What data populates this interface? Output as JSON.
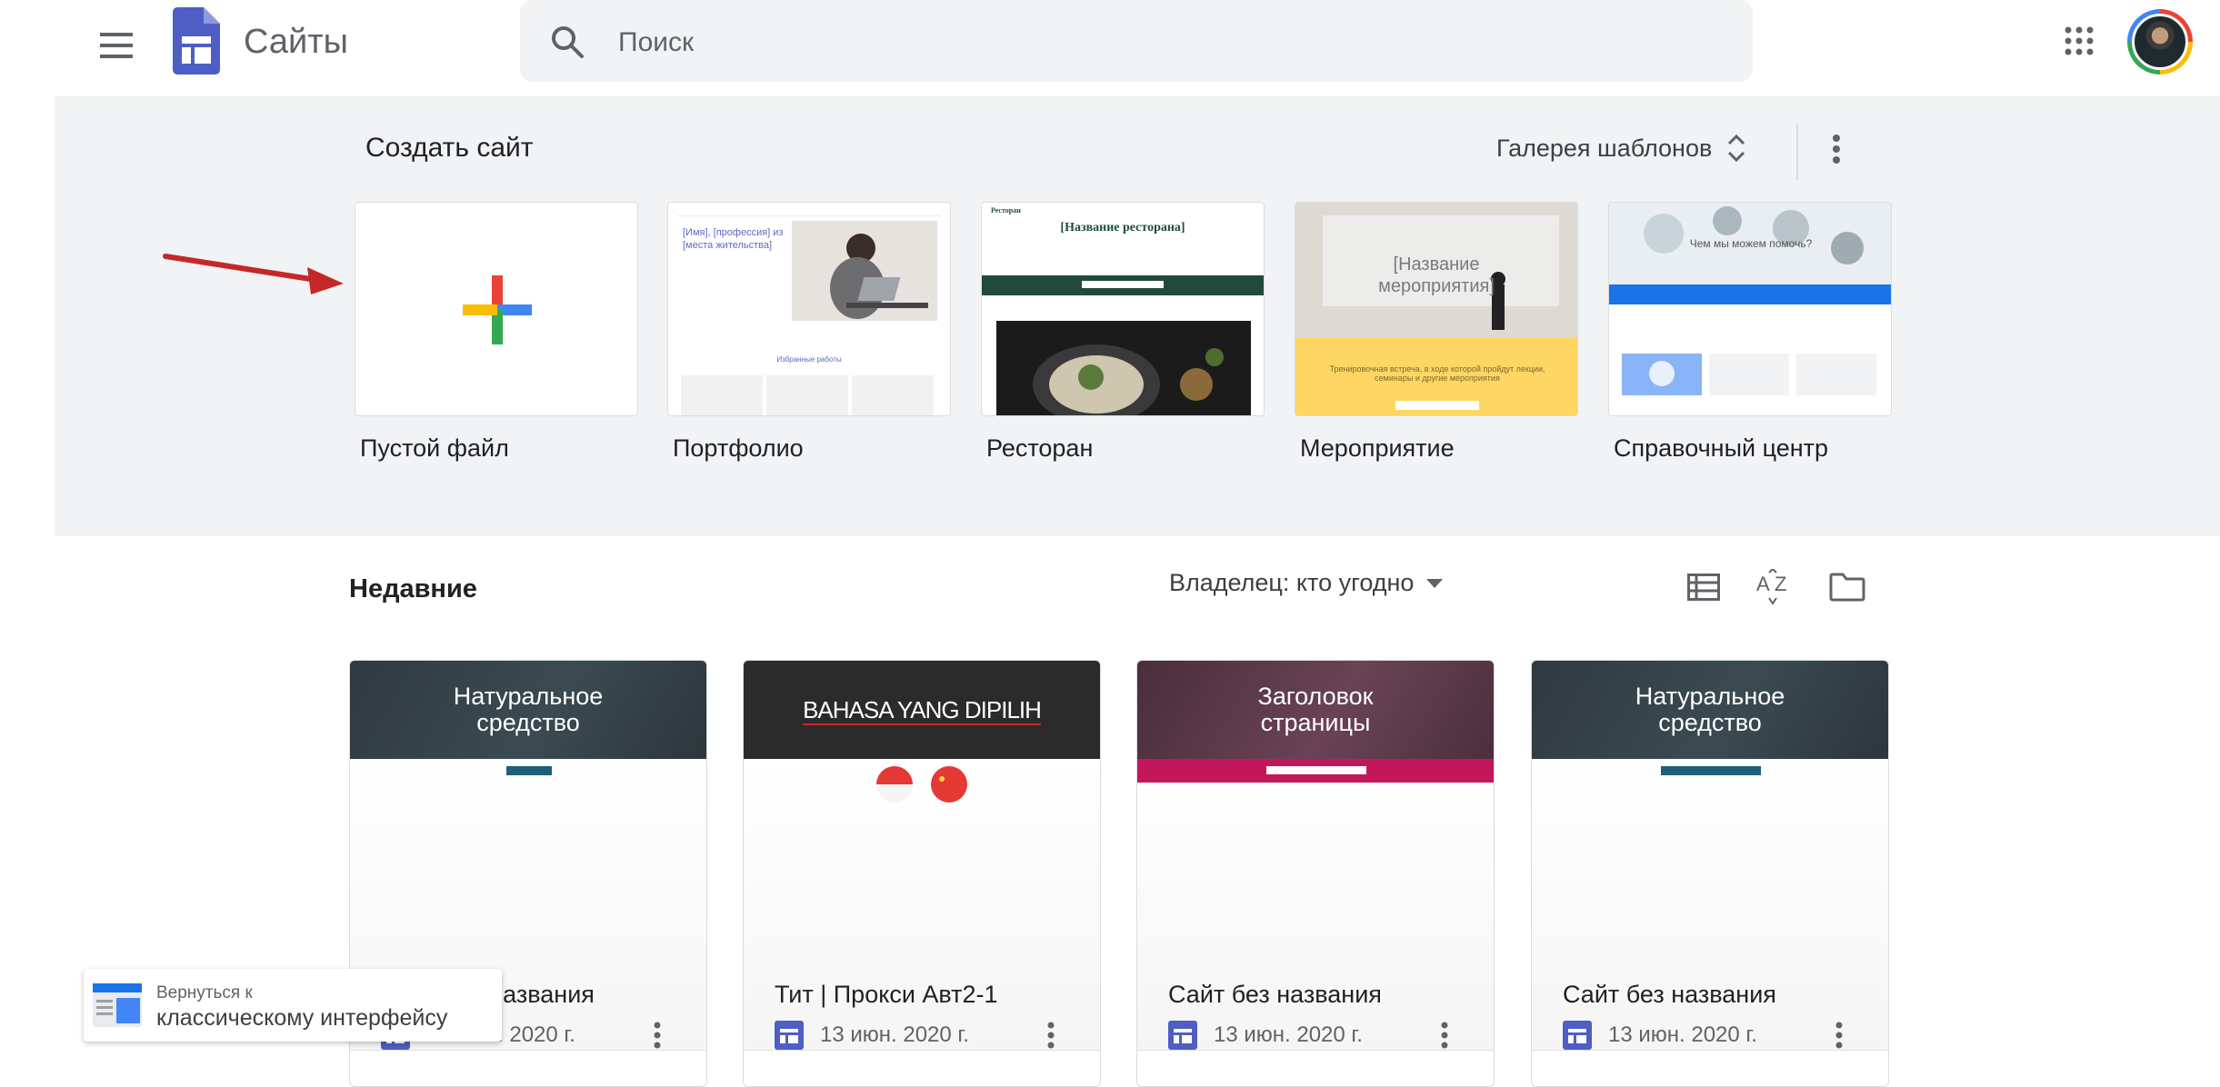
{
  "header": {
    "app_title": "Сайты",
    "search_placeholder": "Поиск",
    "icons": [
      "menu-icon",
      "sites-logo",
      "search-icon",
      "apps-grid-icon",
      "avatar"
    ]
  },
  "gallery": {
    "title": "Создать сайт",
    "gallery_link": "Галерея шаблонов",
    "templates": [
      {
        "label": "Пустой файл"
      },
      {
        "label": "Портфолио",
        "thumb_heading": "[Имя], [профессия] из [места жительства]",
        "thumb_caption": "Избранные работы"
      },
      {
        "label": "Ресторан",
        "thumb_heading": "[Название ресторана]",
        "thumb_nav": "Ресторан"
      },
      {
        "label": "Мероприятие",
        "thumb_heading": "[Название мероприятия]",
        "thumb_caption": "Тренировочная встреча, в ходе которой пройдут лекции, семинары и другие мероприятия"
      },
      {
        "label": "Справочный центр",
        "thumb_heading": "Чем мы можем помочь?"
      }
    ]
  },
  "recent": {
    "title": "Недавние",
    "owner_filter": "Владелец: кто угодно",
    "cards": [
      {
        "hero": "Натуральное средство",
        "title": "Сайт без названия",
        "date": "13 июн. 2020 г."
      },
      {
        "hero": "BAHASA YANG DIPILIH",
        "title": "Тит | Прокси Авт2-1",
        "date": "13 июн. 2020 г."
      },
      {
        "hero": "Заголовок страницы",
        "title": "Сайт без названия",
        "date": "13 июн. 2020 г."
      },
      {
        "hero": "Натуральное средство",
        "title": "Сайт без названия",
        "date": "13 июн. 2020 г."
      }
    ]
  },
  "toast": {
    "line1": "Вернуться к",
    "line2": "классическому интерфейсу"
  },
  "colors": {
    "accent_blue": "#4285f4",
    "gallery_bg": "#f1f3f4",
    "card1_hero": "#37444b",
    "card2_hero": "#2b2b2b",
    "card3_hero": "#5d3a4c",
    "card3_band": "#c2185b",
    "arrow": "#c62828"
  }
}
